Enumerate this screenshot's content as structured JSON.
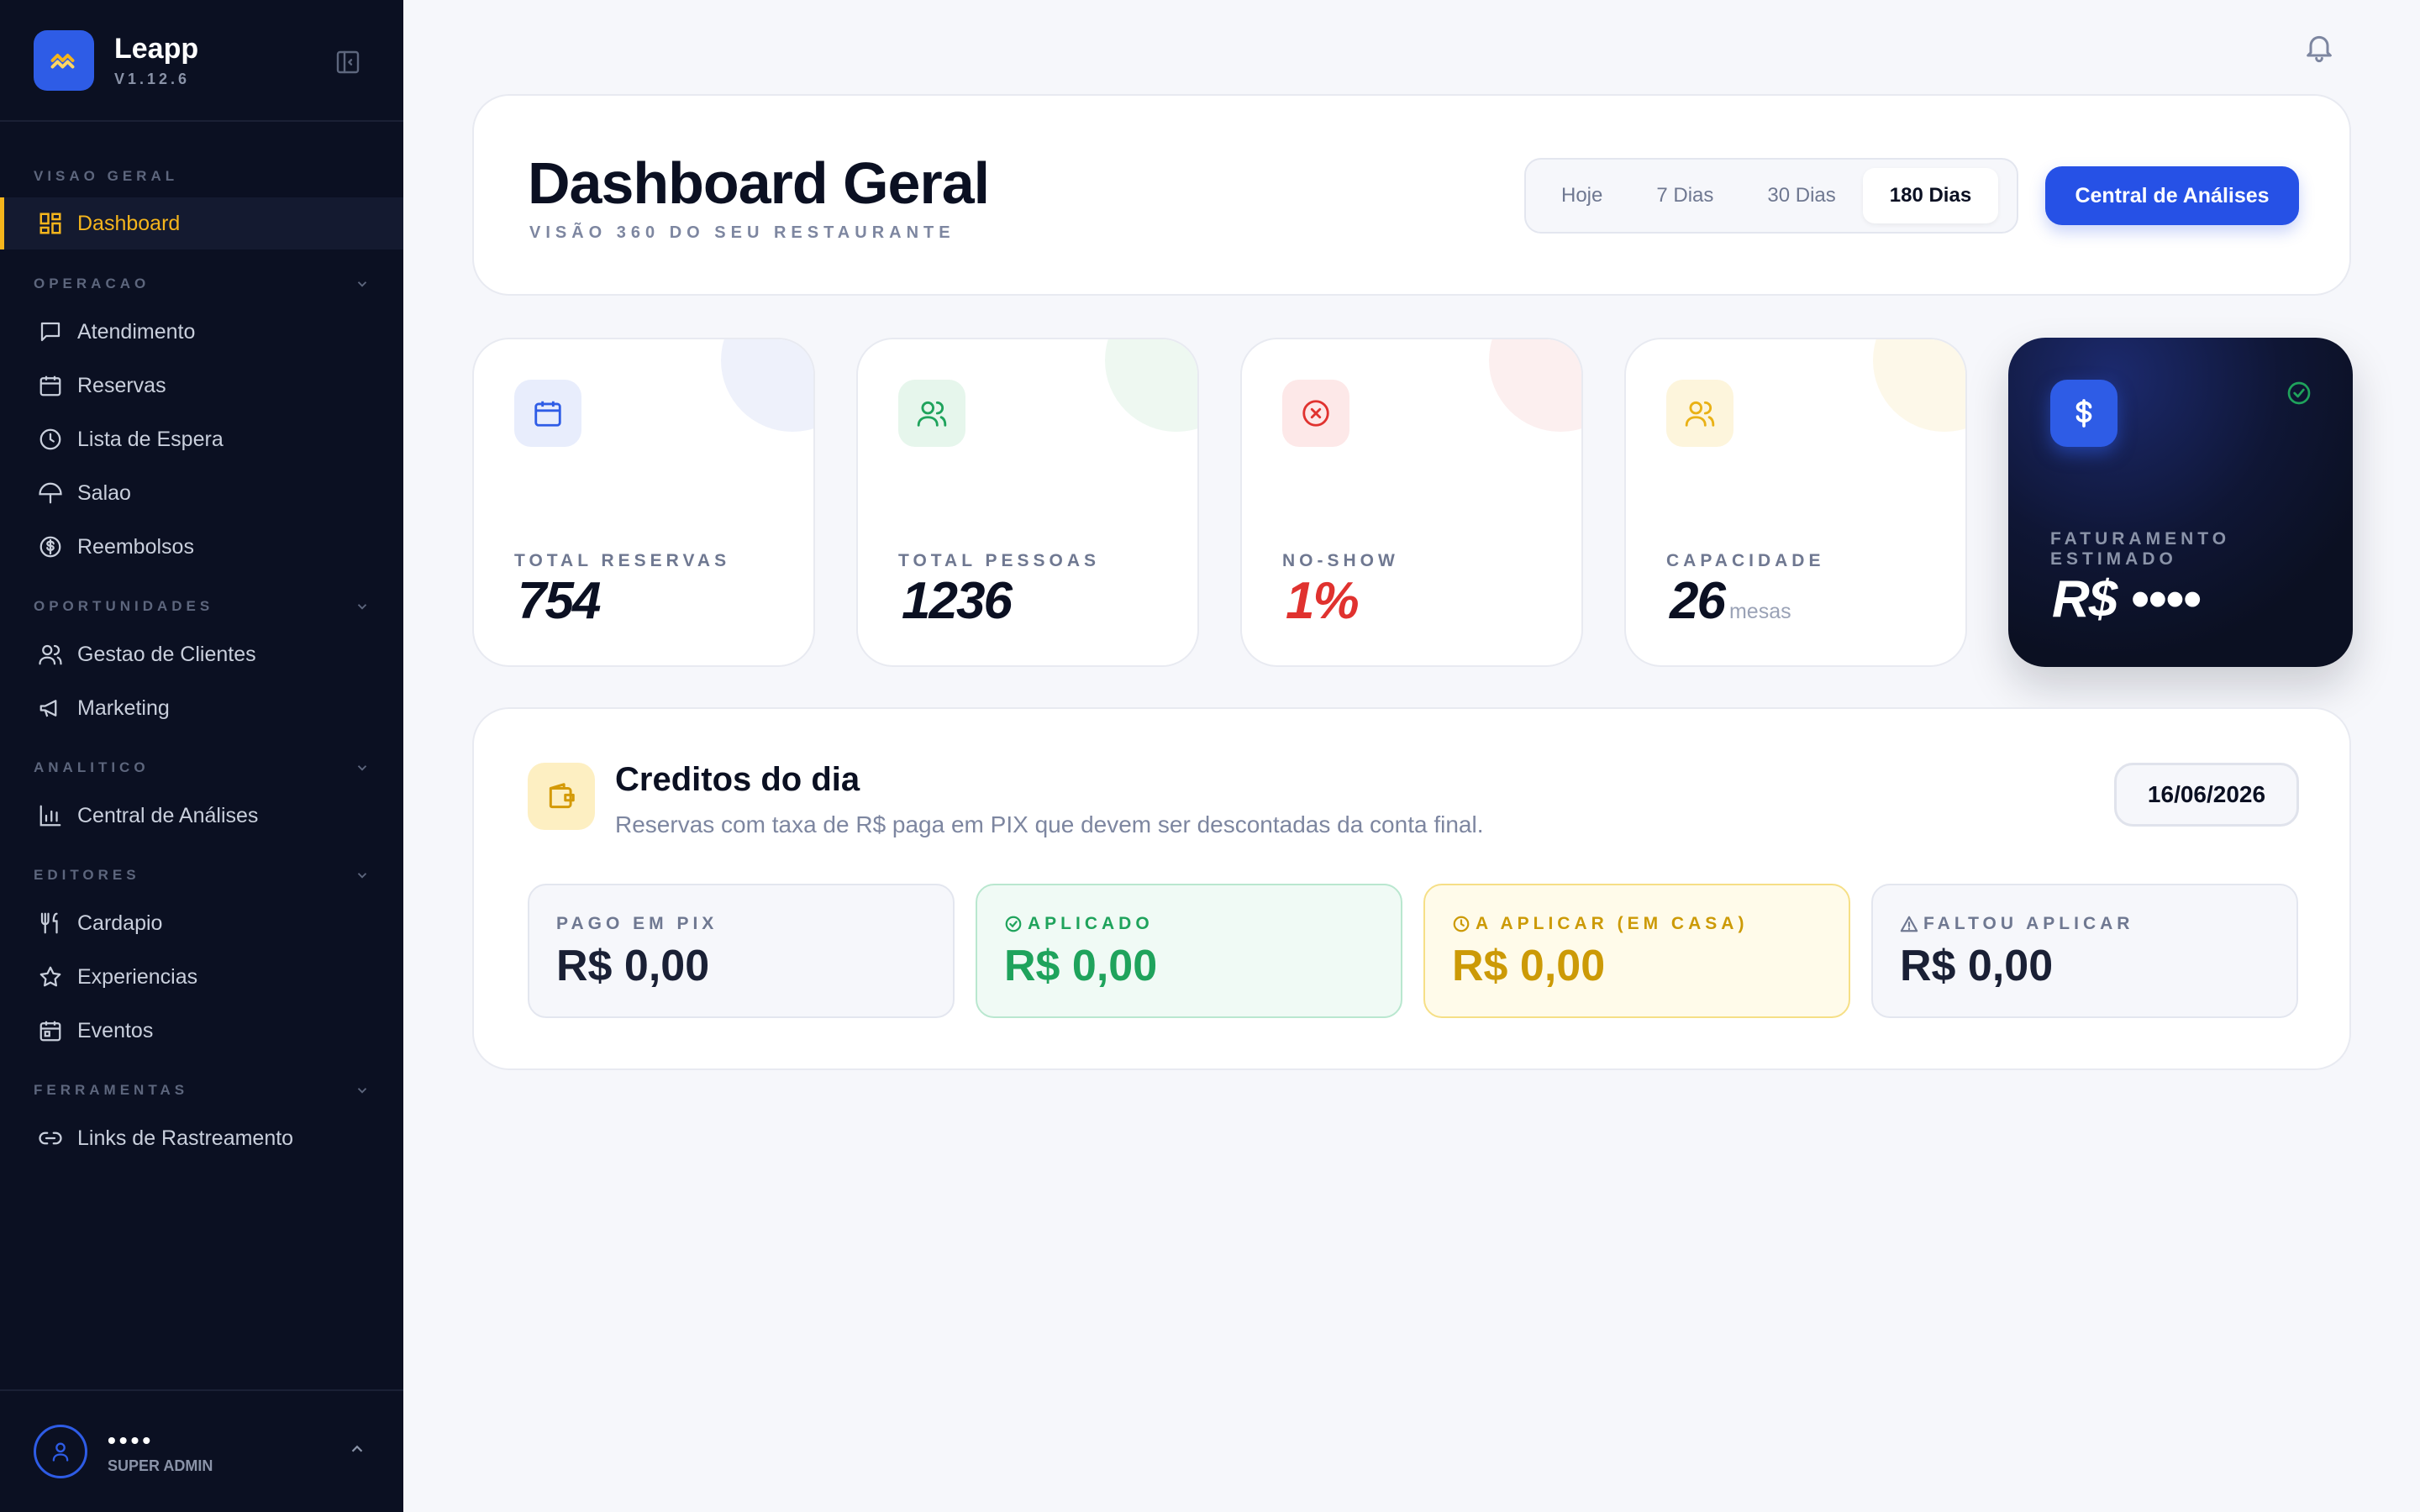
{
  "brand": {
    "name": "Leapp",
    "version": "V1.12.6"
  },
  "sidebar": {
    "sections": [
      {
        "title": "VISAO GERAL",
        "items": [
          {
            "label": "Dashboard",
            "icon": "grid-icon",
            "active": true
          }
        ]
      },
      {
        "title": "OPERACAO",
        "items": [
          {
            "label": "Atendimento",
            "icon": "message-icon"
          },
          {
            "label": "Reservas",
            "icon": "calendar-icon"
          },
          {
            "label": "Lista de Espera",
            "icon": "clock-icon"
          },
          {
            "label": "Salao",
            "icon": "umbrella-icon"
          },
          {
            "label": "Reembolsos",
            "icon": "dollar-circle-icon"
          }
        ]
      },
      {
        "title": "OPORTUNIDADES",
        "items": [
          {
            "label": "Gestao de Clientes",
            "icon": "users-icon"
          },
          {
            "label": "Marketing",
            "icon": "megaphone-icon"
          }
        ]
      },
      {
        "title": "ANALITICO",
        "items": [
          {
            "label": "Central de Análises",
            "icon": "bar-chart-icon"
          }
        ]
      },
      {
        "title": "EDITORES",
        "items": [
          {
            "label": "Cardapio",
            "icon": "utensils-icon"
          },
          {
            "label": "Experiencias",
            "icon": "star-icon"
          },
          {
            "label": "Eventos",
            "icon": "calendar-event-icon"
          }
        ]
      },
      {
        "title": "FERRAMENTAS",
        "items": [
          {
            "label": "Links de Rastreamento",
            "icon": "link-icon"
          }
        ]
      }
    ]
  },
  "user": {
    "name": "••••",
    "role": "SUPER ADMIN"
  },
  "header": {
    "title": "Dashboard Geral",
    "subtitle": "VISÃO 360 DO SEU RESTAURANTE",
    "ranges": [
      "Hoje",
      "7 Dias",
      "30 Dias",
      "180 Dias"
    ],
    "active_range": "180 Dias",
    "primary_button": "Central de Análises"
  },
  "stats": [
    {
      "label": "TOTAL RESERVAS",
      "value": "754",
      "unit": "",
      "icon": "calendar-icon",
      "color": "#2e5ce6"
    },
    {
      "label": "TOTAL PESSOAS",
      "value": "1236",
      "unit": "",
      "icon": "users-icon",
      "color": "#1fa35c"
    },
    {
      "label": "NO-SHOW",
      "value": "1%",
      "unit": "",
      "icon": "x-circle-icon",
      "color": "#e0322f"
    },
    {
      "label": "CAPACIDADE",
      "value": "26",
      "unit": "mesas",
      "icon": "users-icon",
      "color": "#e9b115"
    }
  ],
  "revenue": {
    "label": "FATURAMENTO ESTIMADO",
    "value": "R$ ••••",
    "icon": "dollar-icon",
    "accent": "#2e5ce6"
  },
  "credits": {
    "title": "Creditos do dia",
    "subtitle": "Reservas com taxa de R$ paga em PIX que devem ser descontadas da conta final.",
    "date": "16/06/2026",
    "boxes": [
      {
        "label": "PAGO EM PIX",
        "value": "R$ 0,00"
      },
      {
        "label": "APLICADO",
        "value": "R$ 0,00"
      },
      {
        "label": "A APLICAR (EM CASA)",
        "value": "R$ 0,00"
      },
      {
        "label": "FALTOU APLICAR",
        "value": "R$ 0,00"
      }
    ]
  }
}
